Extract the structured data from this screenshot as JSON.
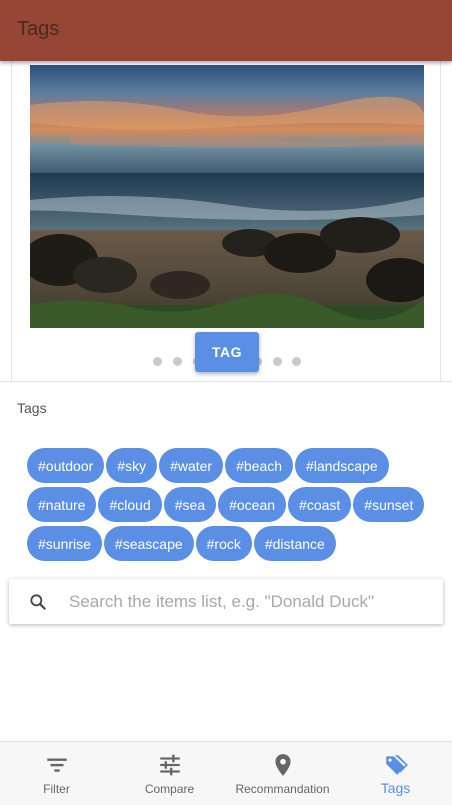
{
  "app": {
    "title": "Tags"
  },
  "carousel": {
    "image_description_icon": "beach-sunset-photo",
    "button_label": "TAG",
    "dot_count": 8,
    "active_dot": 3
  },
  "tags_section": {
    "label": "Tags"
  },
  "tags": [
    [
      "#outdoor",
      "#sky",
      "#water",
      "#beach",
      "#landscape"
    ],
    [
      "#nature",
      "#cloud",
      "#sea",
      "#ocean",
      "#coast",
      "#sunset"
    ],
    [
      "#sunrise",
      "#seascape",
      "#rock",
      "#distance"
    ]
  ],
  "search": {
    "placeholder": "Search the items list, e.g. \"Donald Duck\"",
    "value": "",
    "icon": "search-icon"
  },
  "bottom_nav": {
    "items": [
      {
        "label": "Filter",
        "icon": "filter-icon"
      },
      {
        "label": "Compare",
        "icon": "sliders-icon"
      },
      {
        "label": "Recommandation",
        "icon": "location-pin-icon"
      },
      {
        "label": "Tags",
        "icon": "tag-icon"
      }
    ],
    "active": 3
  },
  "colors": {
    "appbar": "#974535",
    "accent": "#5b8fe6",
    "nav_background": "#f7f7f7"
  }
}
